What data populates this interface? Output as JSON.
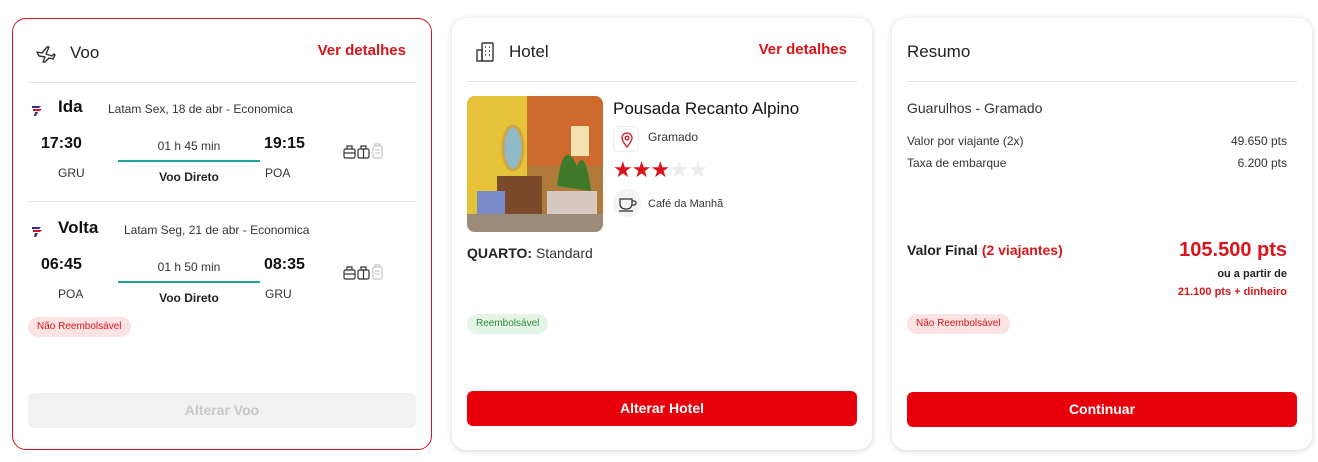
{
  "flight": {
    "title": "Voo",
    "details_link": "Ver detalhes",
    "outbound": {
      "type": "Ida",
      "info": "Latam Sex, 18 de abr - Economica",
      "dep_time": "17:30",
      "dep_code": "GRU",
      "duration": "01 h 45 min",
      "direct": "Voo Direto",
      "arr_time": "19:15",
      "arr_code": "POA"
    },
    "inbound": {
      "type": "Volta",
      "info": "Latam Seg, 21 de abr - Economica",
      "dep_time": "06:45",
      "dep_code": "POA",
      "duration": "01 h 50 min",
      "direct": "Voo Direto",
      "arr_time": "08:35",
      "arr_code": "GRU"
    },
    "badge": "Não Reembolsável",
    "button": "Alterar Voo"
  },
  "hotel": {
    "title": "Hotel",
    "details_link": "Ver detalhes",
    "name": "Pousada Recanto Alpino",
    "location": "Gramado",
    "stars": 3,
    "stars_max": 5,
    "amenity": "Café da Manhã",
    "room_label": "QUARTO:",
    "room_value": "Standard",
    "badge": "Reembolsável",
    "button": "Alterar Hotel"
  },
  "summary": {
    "title": "Resumo",
    "route": "Guarulhos - Gramado",
    "rows": [
      {
        "label": "Valor por viajante (2x)",
        "value": "49.650 pts"
      },
      {
        "label": "Taxa de embarque",
        "value": "6.200 pts"
      }
    ],
    "final_label": "Valor Final",
    "travelers": "(2 viajantes)",
    "final_value": "105.500 pts",
    "alt_prefix": "ou a partir de",
    "alt_value": "21.100 pts + dinheiro",
    "badge": "Não Reembolsável",
    "button": "Continuar"
  },
  "colors": {
    "accent": "#d9151b",
    "button": "#e8000b",
    "duration_line": "#1fa39a"
  }
}
